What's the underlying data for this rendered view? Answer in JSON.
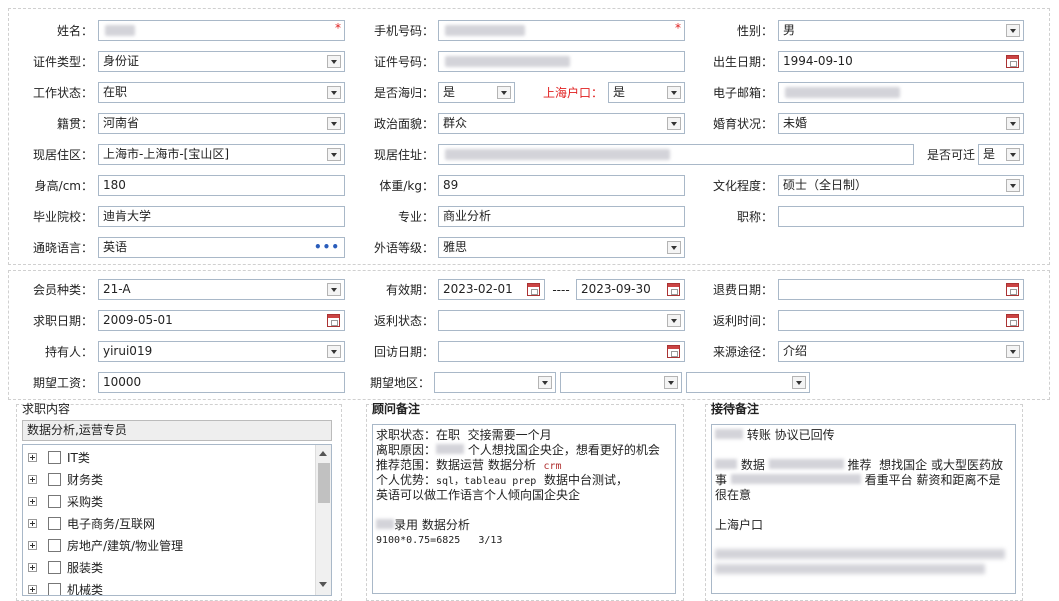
{
  "labels": {
    "name": "姓名：",
    "phone": "手机号码：",
    "gender": "性别：",
    "id_type": "证件类型：",
    "id_number": "证件号码：",
    "birth_date": "出生日期：",
    "work_status": "工作状态：",
    "returnee": "是否海归：",
    "shanghai_hukou": "上海户口：",
    "email": "电子邮箱：",
    "native_place": "籍贯：",
    "political": "政治面貌：",
    "marital": "婚育状况：",
    "residence_area": "现居住区：",
    "residence_address": "现居住址：",
    "accessible": "是否可迁",
    "height": "身高/cm：",
    "weight": "体重/kg：",
    "education": "文化程度：",
    "school": "毕业院校：",
    "major": "专业：",
    "title": "职称：",
    "language": "通晓语言：",
    "foreign_level": "外语等级：",
    "member_type": "会员种类：",
    "valid_period": "有效期：",
    "refund_date": "退费日期：",
    "job_date": "求职日期：",
    "rebate_status": "返利状态：",
    "rebate_time": "返利时间：",
    "holder": "持有人：",
    "visit_date": "回访日期：",
    "source": "来源途径：",
    "expected_salary": "期望工资：",
    "expected_area": "期望地区："
  },
  "values": {
    "gender": "男",
    "id_type": "身份证",
    "birth_date": "1994-09-10",
    "work_status": "在职",
    "returnee": "是",
    "shanghai_hukou": "是",
    "native_place": "河南省",
    "political": "群众",
    "marital": "未婚",
    "residence_area": "上海市-上海市-[宝山区]",
    "accessible": "是",
    "height": "180",
    "weight": "89",
    "education": "硕士（全日制）",
    "school": "迪肯大学",
    "major": "商业分析",
    "title": "",
    "language": "英语",
    "language_more": "•••",
    "foreign_level": "雅思",
    "member_type": "21-A",
    "valid_from": "2023-02-01",
    "valid_sep": "----",
    "valid_to": "2023-09-30",
    "refund_date": "",
    "job_date": "2009-05-01",
    "rebate_status": "",
    "rebate_time": "",
    "holder": "yirui019",
    "visit_date": "",
    "source": "介绍",
    "expected_salary": "10000",
    "required_mark": "*"
  },
  "job_content": {
    "title": "求职内容",
    "selected": "数据分析,运营专员",
    "tree": [
      "IT类",
      "财务类",
      "采购类",
      "电子商务/互联网",
      "房地产/建筑/物业管理",
      "服装类",
      "机械类"
    ]
  },
  "advisor_notes": {
    "title": "顾问备注",
    "lines": [
      "求职状态：在职  交接需要一个月",
      "离职原因：",
      " 个人想找国企央企，想看更好的机会",
      "推荐范围：数据运营 数据分析  ",
      "crm",
      "个人优势：",
      "sql，tableau prep",
      "  数据中台测试，",
      "英语可以做工作语言个人倾向国企央企",
      "录用 数据分析",
      "9100*0.75=6825   3/13"
    ]
  },
  "reception_notes": {
    "title": "接待备注",
    "lines": [
      "转账 协议已回传",
      "数据",
      "推荐  想找国企 或大型医药放",
      "事",
      "看重平台 薪资和距离不是",
      "很在意",
      "上海户口"
    ]
  },
  "icons": {
    "dropdown": "chevron-down-icon",
    "calendar": "calendar-icon",
    "more": "ellipsis-icon",
    "expand": "plus-box-icon",
    "checkbox": "checkbox-icon"
  }
}
